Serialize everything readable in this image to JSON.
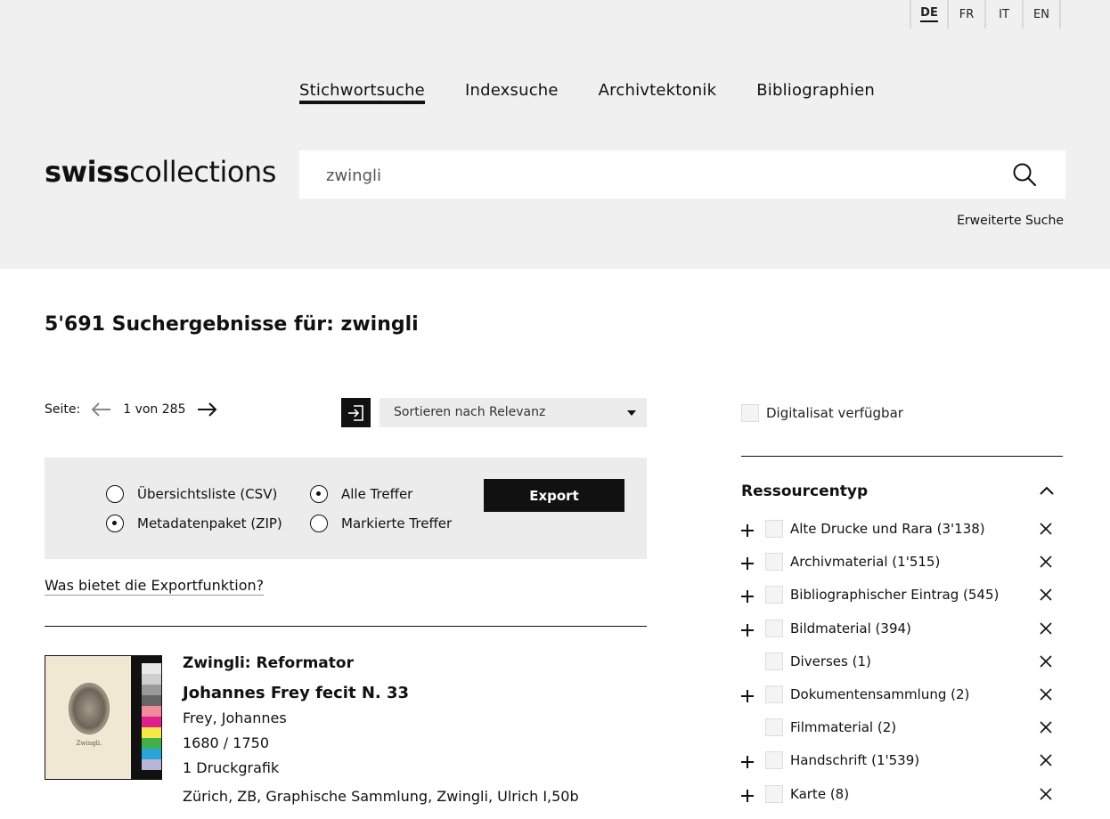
{
  "languages": [
    {
      "code": "DE",
      "active": true
    },
    {
      "code": "FR",
      "active": false
    },
    {
      "code": "IT",
      "active": false
    },
    {
      "code": "EN",
      "active": false
    }
  ],
  "nav": {
    "items": [
      "Stichwortsuche",
      "Indexsuche",
      "Archivtektonik",
      "Bibliographien"
    ],
    "active": "Stichwortsuche"
  },
  "logo": {
    "bold": "swiss",
    "light": "collections"
  },
  "search": {
    "value": "zwingli",
    "icon": "search-icon",
    "advanced_label": "Erweiterte Suche"
  },
  "results": {
    "title": "5'691 Suchergebnisse für: zwingli",
    "page_label": "Seite:",
    "page_info": "1 von 285",
    "sort_label": "Sortieren nach Relevanz"
  },
  "export": {
    "options_format": [
      {
        "label": "Übersichtsliste (CSV)",
        "checked": false
      },
      {
        "label": "Metadatenpaket (ZIP)",
        "checked": true
      }
    ],
    "options_scope": [
      {
        "label": "Alle Treffer",
        "checked": true
      },
      {
        "label": "Markierte Treffer",
        "checked": false
      }
    ],
    "button_label": "Export",
    "help_link": "Was bietet die Exportfunktion?"
  },
  "result_item": {
    "title": "Zwingli: Reformator",
    "subtitle": "Johannes Frey fecit N. 33",
    "author": "Frey, Johannes",
    "date": "1680 / 1750",
    "extent": "1 Druckgrafik",
    "location": "Zürich, ZB, Graphische Sammlung, Zwingli, Ulrich I,50b",
    "thumb_caption": "Zwingli."
  },
  "filters": {
    "digital_label": "Digitalisat verfügbar",
    "facet_title": "Ressourcentyp",
    "facets": [
      {
        "label": "Alte Drucke und Rara",
        "count": "(3'138)",
        "expandable": true
      },
      {
        "label": "Archivmaterial",
        "count": "(1'515)",
        "expandable": true
      },
      {
        "label": "Bibliographischer Eintrag",
        "count": "(545)",
        "expandable": true
      },
      {
        "label": "Bildmaterial",
        "count": "(394)",
        "expandable": true
      },
      {
        "label": "Diverses",
        "count": "(1)",
        "expandable": false
      },
      {
        "label": "Dokumentensammlung",
        "count": "(2)",
        "expandable": true
      },
      {
        "label": "Filmmaterial",
        "count": "(2)",
        "expandable": false
      },
      {
        "label": "Handschrift",
        "count": "(1'539)",
        "expandable": true
      },
      {
        "label": "Karte",
        "count": "(8)",
        "expandable": true
      }
    ]
  }
}
